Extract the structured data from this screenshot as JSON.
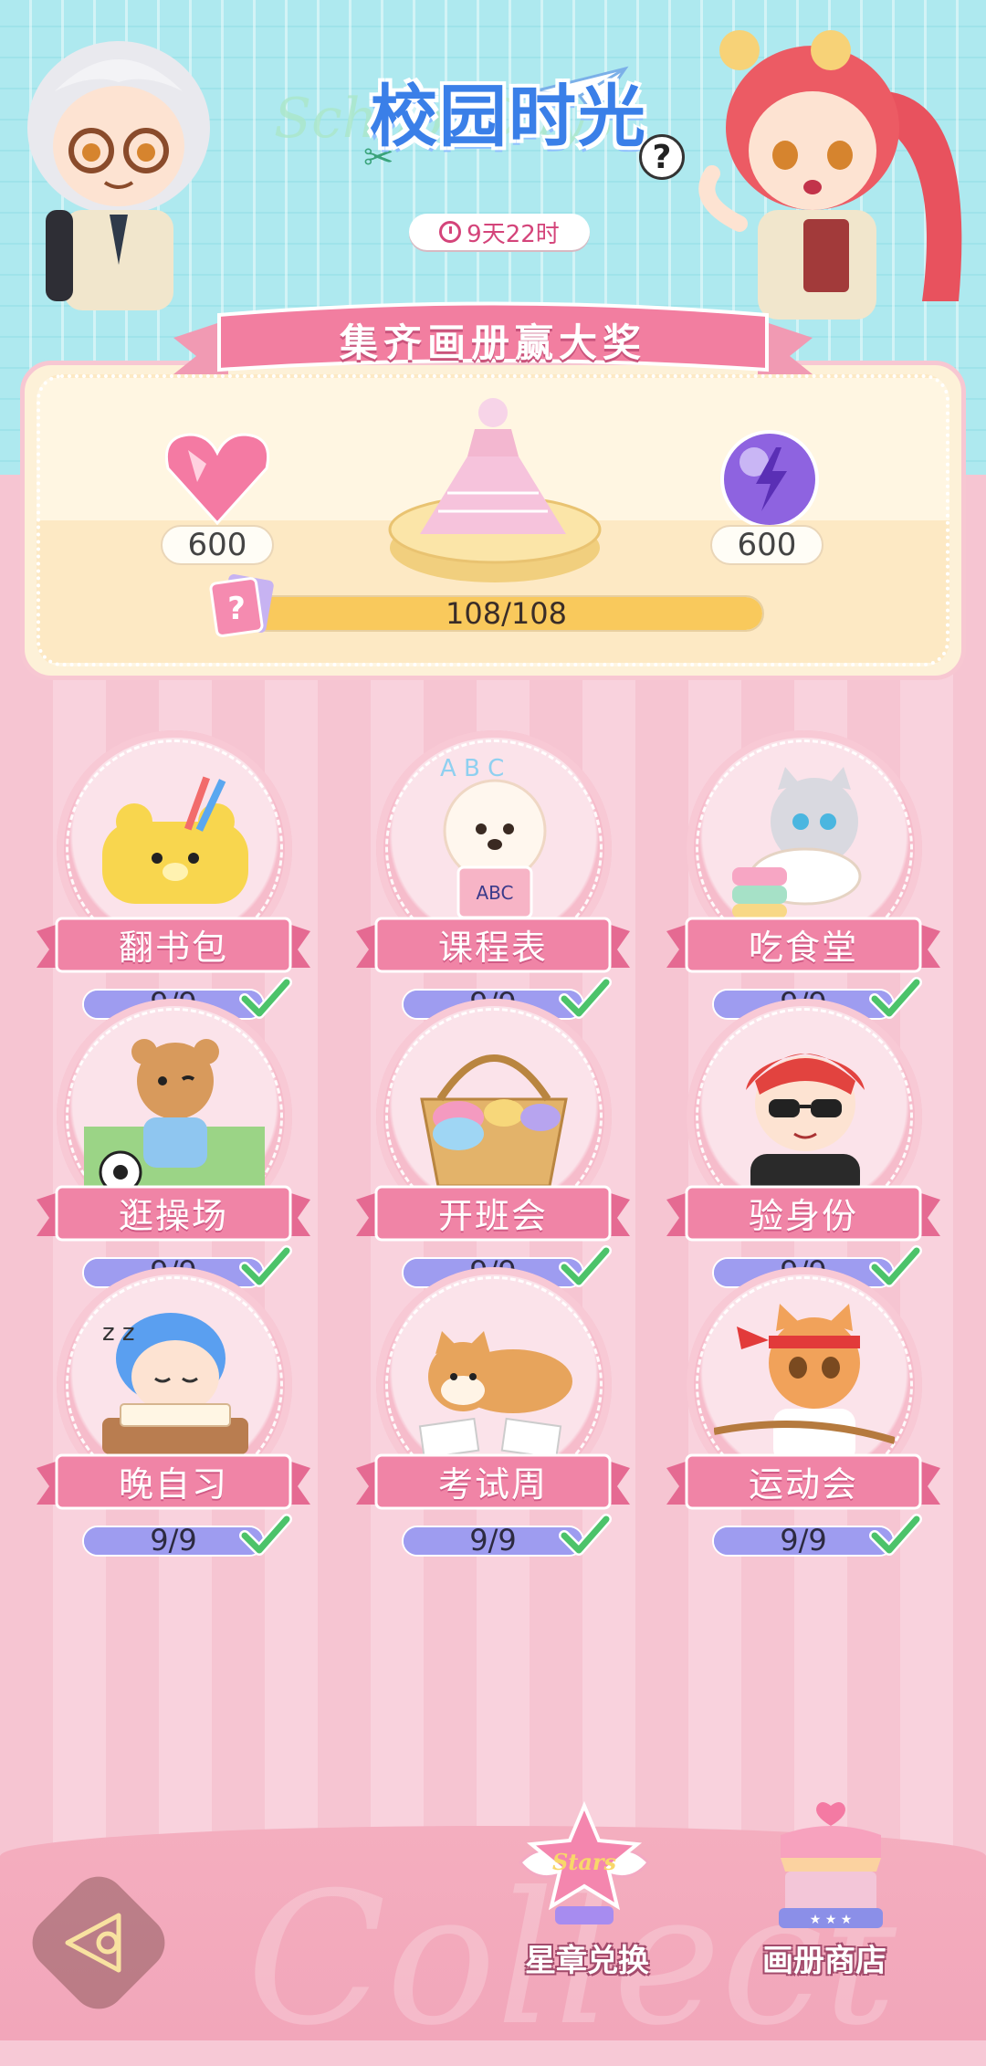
{
  "header": {
    "title": "校园时光",
    "help_label": "?",
    "timer": "9天22时"
  },
  "reward": {
    "banner": "集齐画册赢大奖",
    "left_amount": "600",
    "right_amount": "600",
    "progress_text": "108/108",
    "progress_fraction": 1.0
  },
  "albums": [
    {
      "label": "翻书包",
      "progress": "9/9",
      "complete": true,
      "fraction": 1.0
    },
    {
      "label": "课程表",
      "progress": "9/9",
      "complete": true,
      "fraction": 1.0
    },
    {
      "label": "吃食堂",
      "progress": "9/9",
      "complete": true,
      "fraction": 1.0
    },
    {
      "label": "逛操场",
      "progress": "9/9",
      "complete": true,
      "fraction": 1.0
    },
    {
      "label": "开班会",
      "progress": "9/9",
      "complete": true,
      "fraction": 1.0
    },
    {
      "label": "验身份",
      "progress": "9/9",
      "complete": true,
      "fraction": 1.0
    },
    {
      "label": "晚自习",
      "progress": "9/9",
      "complete": true,
      "fraction": 1.0
    },
    {
      "label": "考试周",
      "progress": "9/9",
      "complete": true,
      "fraction": 1.0
    },
    {
      "label": "运动会",
      "progress": "9/9",
      "complete": true,
      "fraction": 1.0
    }
  ],
  "bottom_bar": {
    "star_exchange_label": "星章兑换",
    "album_shop_label": "画册商店"
  },
  "colors": {
    "accent_pink": "#f48fb1",
    "title_blue": "#3a7fe8",
    "progress_gold": "#f9c95c",
    "album_progress": "#a9a6f4",
    "check_green": "#4cc36a"
  }
}
